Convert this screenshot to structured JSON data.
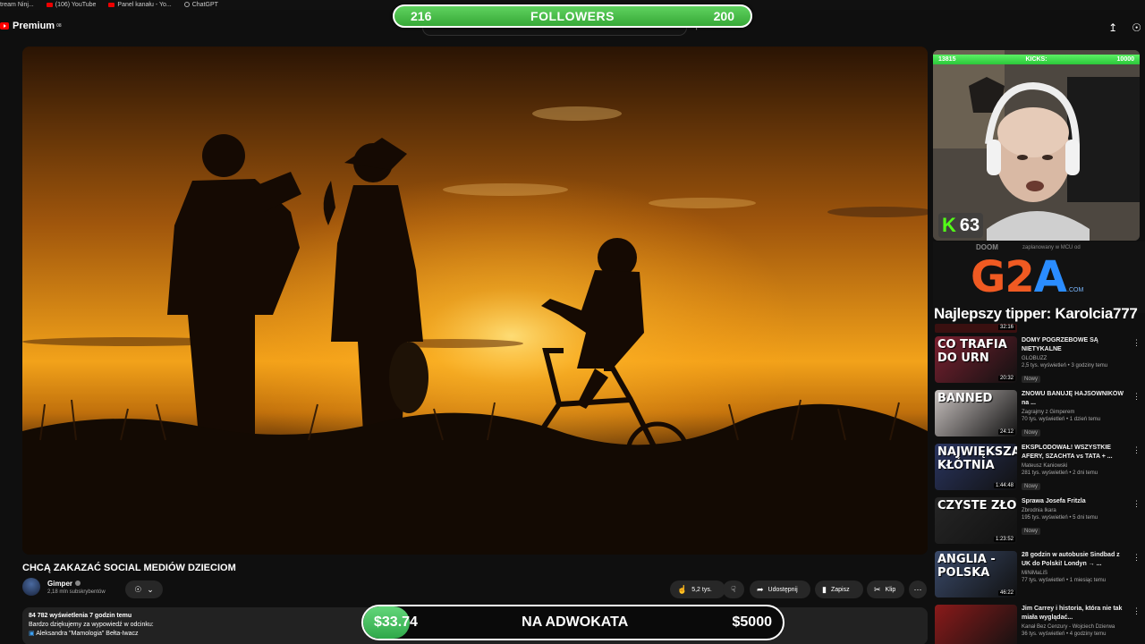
{
  "bookmarks": [
    "tream Ninj...",
    "(106) YouTube",
    "Panel kanału - Yo...",
    "ChatGPT"
  ],
  "header": {
    "logo_label": "Premium",
    "logo_sup": "08"
  },
  "overlay_followers": {
    "left": "216",
    "label": "FOLLOWERS",
    "right": "200"
  },
  "video": {
    "title": "CHCĄ ZAKAZAĆ SOCIAL MEDIÓW DZIECIOM",
    "channel_name": "Gimper",
    "subscribers": "2,18 mln subskrybentów",
    "likes": "5,2 tys.",
    "share_label": "Udostępnij",
    "save_label": "Zapisz",
    "clip_label": "Klip",
    "views_line": "84 782 wyświetlenia  7 godzin temu",
    "desc_line1": "Bardzo dziękujemy za wypowiedź w odcinku:",
    "desc_line2": "Aleksandra \"Mamologia\" Bełta-Iwacz"
  },
  "overlay_donation": {
    "current": "$33.74",
    "label": "NA ADWOKATA",
    "goal": "$5000",
    "progress": 0.0067
  },
  "kicks_bar": {
    "left": "13815",
    "label": "KICKS:",
    "right": "10000"
  },
  "kick_badge": {
    "icon": "K",
    "count": "63"
  },
  "sponsor": {
    "logo_g": "G2",
    "logo_a": "A",
    "domain": ".COM",
    "bg_text1": "DOOM",
    "bg_text2": "zaplanowany w MCU od"
  },
  "tipper": "Najlepszy tipper: Karolcia777",
  "tipper_duration": "32:16",
  "colors": {
    "followers_bar": "#37a837",
    "donation_fill": "#2fa84a",
    "kick_green": "#53fc18",
    "g2a_orange": "#f05a22",
    "g2a_blue": "#2a8cff"
  },
  "recommended": [
    {
      "title": "DOMY POGRZEBOWE SĄ NIETYKALNE",
      "channel": "GLOBUZZ",
      "stats": "2,5 tys. wyświetleń • 3 godziny temu",
      "badge": "Nowy",
      "duration": "20:32",
      "overlay": "CO TRAFIA DO URN",
      "thumb": "#7a2030"
    },
    {
      "title": "ZNOWU BANUJĘ HAJSOWNIKÓW na ...",
      "channel": "Zagrajmy z Gimperem",
      "stats": "70 tys. wyświetleń • 1 dzień temu",
      "badge": "Nowy",
      "duration": "24:12",
      "overlay": "BANNED",
      "thumb": "#c9c2c0"
    },
    {
      "title": "EKSPLODOWAŁ! WSZYSTKIE AFERY, SZACHTA vs TATA + ...",
      "channel": "Mateusz Kaniowski",
      "stats": "281 tys. wyświetleń • 2 dni temu",
      "badge": "Nowy",
      "duration": "1:44:48",
      "overlay": "NAJWIĘKSZA KŁÓTNIA",
      "thumb": "#2a3560"
    },
    {
      "title": "Sprawa Josefa Fritzla",
      "channel": "Zbrodnia Ikara",
      "stats": "195 tys. wyświetleń • 5 dni temu",
      "badge": "Nowy",
      "duration": "1:23:52",
      "overlay": "CZYSTE ZŁO",
      "thumb": "#262626"
    },
    {
      "title": "28 godzin w autobusie Sindbad z UK do Polski! Londyn → ...",
      "channel": "MiNiMaLiS",
      "stats": "77 tys. wyświetleń • 1 miesiąc temu",
      "badge": "",
      "duration": "46:22",
      "overlay": "ANGLIA - POLSKA",
      "thumb": "#3a4a6a"
    },
    {
      "title": "Jim Carrey i historia, która nie tak miała wyglądać...",
      "channel": "Kanał Bez Cenzury - Wojciech Dzierwa",
      "stats": "36 tys. wyświetleń • 4 godziny temu",
      "badge": "",
      "duration": "22:18",
      "overlay": "",
      "thumb": "#8a1a1a"
    }
  ]
}
